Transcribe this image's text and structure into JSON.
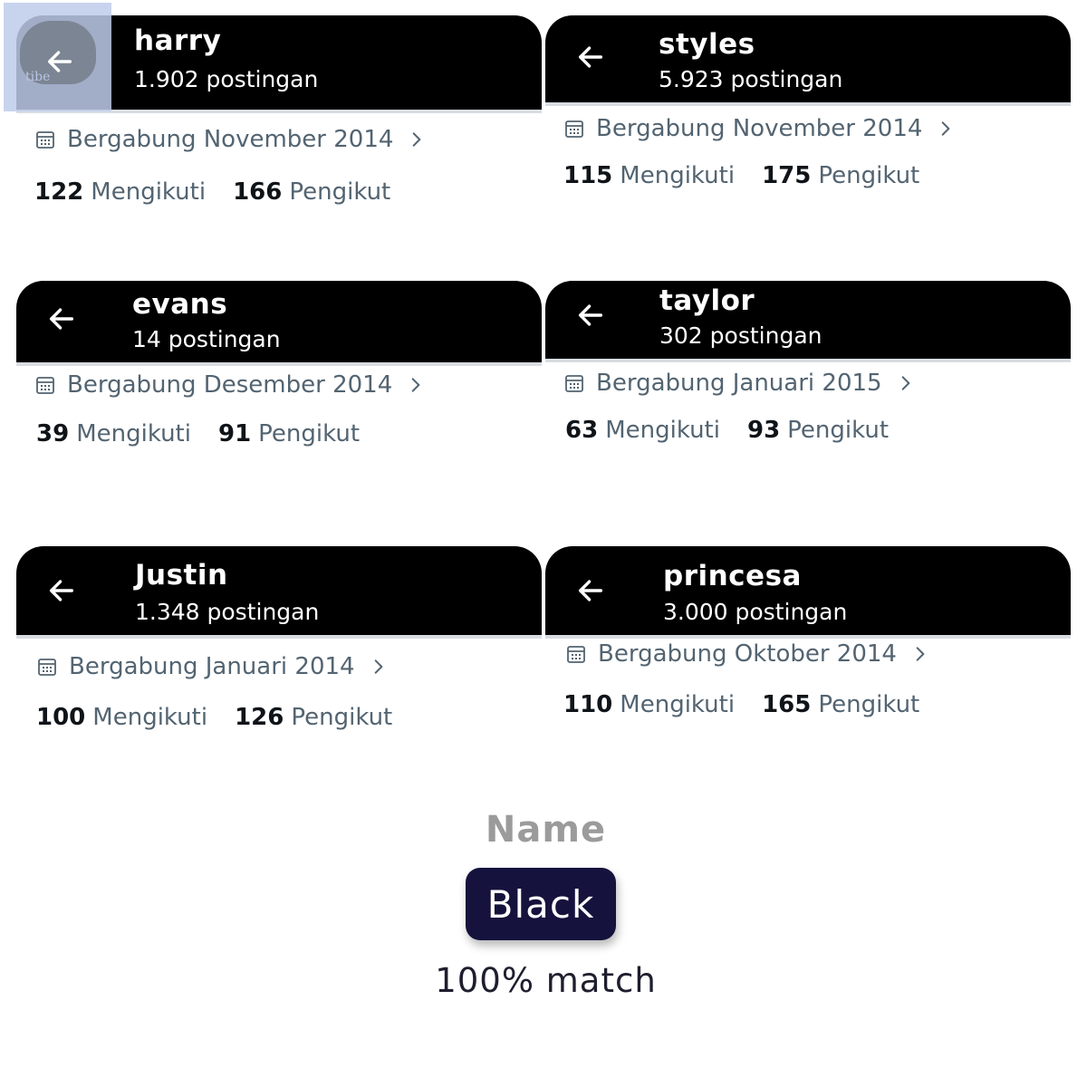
{
  "profiles": [
    {
      "name": "harry",
      "posts": "1.902 postingan",
      "joined": "Bergabung November 2014",
      "following_count": "122",
      "following_label": "Mengikuti",
      "followers_count": "166",
      "followers_label": "Pengikut"
    },
    {
      "name": "styles",
      "posts": "5.923 postingan",
      "joined": "Bergabung November 2014",
      "following_count": "115",
      "following_label": "Mengikuti",
      "followers_count": "175",
      "followers_label": "Pengikut"
    },
    {
      "name": "evans",
      "posts": "14 postingan",
      "joined": "Bergabung Desember 2014",
      "following_count": "39",
      "following_label": "Mengikuti",
      "followers_count": "91",
      "followers_label": "Pengikut"
    },
    {
      "name": "taylor",
      "posts": "302 postingan",
      "joined": "Bergabung Januari 2015",
      "following_count": "63",
      "following_label": "Mengikuti",
      "followers_count": "93",
      "followers_label": "Pengikut"
    },
    {
      "name": "Justin",
      "posts": "1.348 postingan",
      "joined": "Bergabung Januari 2014",
      "following_count": "100",
      "following_label": "Mengikuti",
      "followers_count": "126",
      "followers_label": "Pengikut"
    },
    {
      "name": "princesa",
      "posts": "3.000 postingan",
      "joined": "Bergabung Oktober 2014",
      "following_count": "110",
      "following_label": "Mengikuti",
      "followers_count": "165",
      "followers_label": "Pengikut"
    }
  ],
  "overlay": {
    "watermark": "tibe"
  },
  "result": {
    "label": "Name",
    "value": "Black",
    "match": "100% match"
  },
  "icons": {
    "back": "arrow-left-icon",
    "calendar": "calendar-icon",
    "chevron": "chevron-right-icon"
  },
  "colors": {
    "header_bg": "#000000",
    "secondary_text": "#536471",
    "badge_bg": "#15133d"
  }
}
